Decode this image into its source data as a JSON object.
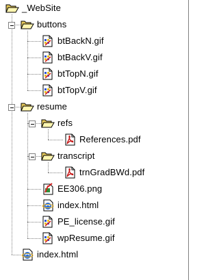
{
  "tree": [
    {
      "name": "folder-website",
      "label": "_WebSite",
      "icon": "folder-open-icon",
      "depth": 0,
      "expanded": true
    },
    {
      "name": "folder-buttons",
      "label": "buttons",
      "icon": "folder-open-icon",
      "depth": 1,
      "expanded": true
    },
    {
      "name": "file-btbackn",
      "label": "btBackN.gif",
      "icon": "gif-image-icon",
      "depth": 2
    },
    {
      "name": "file-btbackv",
      "label": "btBackV.gif",
      "icon": "gif-image-icon",
      "depth": 2
    },
    {
      "name": "file-bttopn",
      "label": "btTopN.gif",
      "icon": "gif-image-icon",
      "depth": 2
    },
    {
      "name": "file-btopv",
      "label": "btTopV.gif",
      "icon": "gif-image-icon",
      "depth": 2
    },
    {
      "name": "folder-resume",
      "label": "resume",
      "icon": "folder-open-icon",
      "depth": 1,
      "expanded": true
    },
    {
      "name": "folder-refs",
      "label": "refs",
      "icon": "folder-open-icon",
      "depth": 2,
      "expanded": true
    },
    {
      "name": "file-references",
      "label": "References.pdf",
      "icon": "pdf-file-icon",
      "depth": 3
    },
    {
      "name": "folder-transcript",
      "label": "transcript",
      "icon": "folder-open-icon",
      "depth": 2,
      "expanded": true
    },
    {
      "name": "file-trngradbwd",
      "label": "trnGradBWd.pdf",
      "icon": "pdf-file-icon",
      "depth": 3
    },
    {
      "name": "file-ee306",
      "label": "EE306.png",
      "icon": "png-image-icon",
      "depth": 2
    },
    {
      "name": "file-resume-index",
      "label": "index.html",
      "icon": "html-file-icon",
      "depth": 2
    },
    {
      "name": "file-pe-license",
      "label": "PE_license.gif",
      "icon": "gif-image-icon",
      "depth": 2
    },
    {
      "name": "file-wpresume",
      "label": "wpResume.gif",
      "icon": "gif-image-icon",
      "depth": 2
    },
    {
      "name": "file-root-index",
      "label": "index.html",
      "icon": "html-file-icon",
      "depth": 1
    }
  ]
}
